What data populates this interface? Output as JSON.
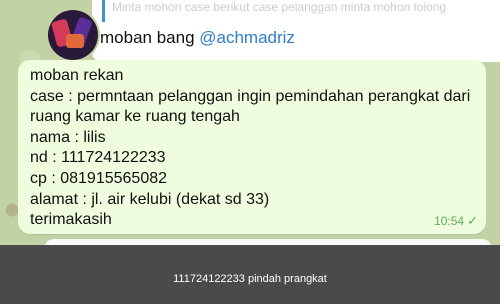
{
  "quoted_preview": "Minta mohon case berikut case pelanggan minta mohon tolong",
  "reply": {
    "text": "moban bang ",
    "mention": "@achmadriz"
  },
  "message": {
    "lines": [
      "moban rekan",
      "case : permntaan pelanggan ingin pemindahan perangkat dari",
      "ruang kamar ke ruang tengah",
      "nama : lilis",
      "nd : 111724122233",
      "cp : 081915565082",
      "alamat : jl. air kelubi (dekat sd 33)",
      "terimakasih"
    ],
    "time": "10:54",
    "status_icon": "check-icon"
  },
  "caption": "111724122233 pindah prangkat",
  "colors": {
    "chat_background": "#c3d2a4",
    "outgoing_bubble": "#effdde",
    "mention": "#2f7ec4",
    "time": "#5fae56",
    "caption_bar": "#4a4a4a"
  }
}
